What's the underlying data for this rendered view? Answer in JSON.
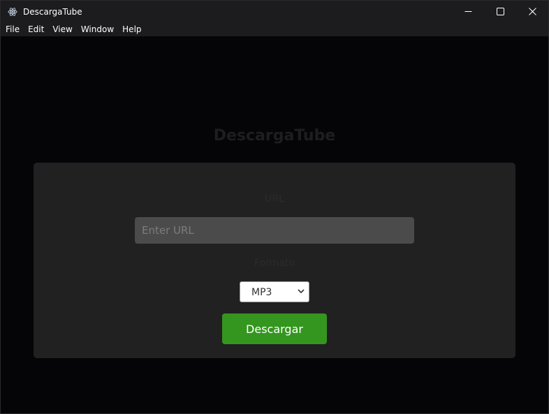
{
  "window": {
    "title": "DescargaTube",
    "icon": "electron-icon",
    "controls": [
      "minimize-icon",
      "maximize-icon",
      "close-icon"
    ]
  },
  "menubar": {
    "items": [
      "File",
      "Edit",
      "View",
      "Window",
      "Help"
    ]
  },
  "main": {
    "heading": "DescargaTube",
    "url_label": "URL",
    "url_input": {
      "placeholder": "Enter URL",
      "value": ""
    },
    "format_label": "Formato",
    "format_select": {
      "selected": "MP3"
    },
    "download_button": "Descargar"
  },
  "colors": {
    "background": "#050508",
    "titlebar": "#1c1c1f",
    "card": "#212121",
    "input": "#4b4b4b",
    "accent_button": "#34961f"
  }
}
